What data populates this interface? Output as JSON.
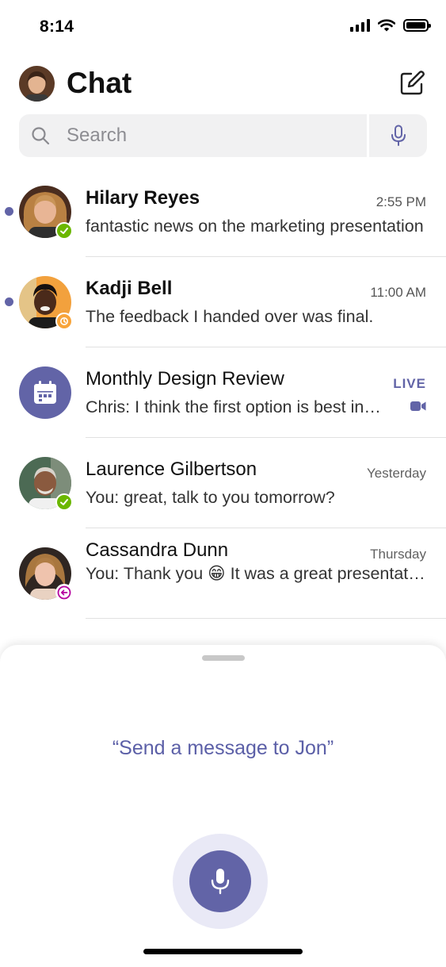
{
  "status_bar": {
    "time": "8:14",
    "icons": [
      "signal-icon",
      "wifi-icon",
      "battery-icon"
    ]
  },
  "header": {
    "title": "Chat",
    "compose_icon": "compose-icon"
  },
  "search": {
    "placeholder": "Search",
    "icon": "search-icon",
    "voice_icon": "microphone-icon"
  },
  "chats": [
    {
      "name": "Hilary Reyes",
      "time": "2:55 PM",
      "preview": "fantastic news on the marketing presentation",
      "unread": true,
      "presence": "available"
    },
    {
      "name": "Kadji Bell",
      "time": "11:00 AM",
      "preview": "The feedback I handed over was final.",
      "unread": true,
      "presence": "away"
    },
    {
      "name": "Monthly Design Review",
      "badge": "LIVE",
      "preview": "Chris: I think the first option is best in…",
      "unread": false,
      "icon": "calendar-icon"
    },
    {
      "name": "Laurence Gilbertson",
      "time": "Yesterday",
      "preview": "You: great, talk to you tomorrow?",
      "unread": false,
      "presence": "available"
    },
    {
      "name": "Cassandra Dunn",
      "time": "Thursday",
      "preview": "You: Thank you 😁 It was a great presentation",
      "unread": false,
      "presence": "out-of-office"
    }
  ],
  "voice_sheet": {
    "prompt": "“Send a message to Jon”",
    "mic_icon": "microphone-icon"
  },
  "colors": {
    "accent": "#6264a7",
    "available": "#6bb700",
    "away": "#f8a43a",
    "out_of_office": "#b4009e"
  }
}
